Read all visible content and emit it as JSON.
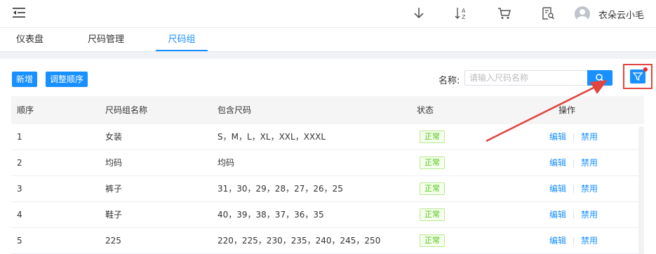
{
  "header": {
    "icons": [
      "menu-fold-icon",
      "download-icon",
      "sort-az-icon",
      "cart-icon",
      "document-search-icon"
    ],
    "username": "衣朵云小毛"
  },
  "tabs": [
    {
      "label": "仪表盘",
      "active": false
    },
    {
      "label": "尺码管理",
      "active": false
    },
    {
      "label": "尺码组",
      "active": true
    }
  ],
  "toolbar": {
    "add_label": "新增",
    "reorder_label": "调整顺序",
    "search_label": "名称:",
    "search_placeholder": "请输入尺码名称",
    "search_value": ""
  },
  "table": {
    "columns": [
      "顺序",
      "尺码组名称",
      "包含尺码",
      "状态",
      "操作"
    ],
    "rows": [
      {
        "order": "1",
        "name": "女装",
        "sizes": "S，M，L，XL，XXL，XXXL",
        "status": "正常"
      },
      {
        "order": "2",
        "name": "均码",
        "sizes": "均码",
        "status": "正常"
      },
      {
        "order": "3",
        "name": "裤子",
        "sizes": "31，30，29，28，27，26，25",
        "status": "正常"
      },
      {
        "order": "4",
        "name": "鞋子",
        "sizes": "40，39，38，37，36，35",
        "status": "正常"
      },
      {
        "order": "5",
        "name": "225",
        "sizes": "220，225，230，235，240，245，250",
        "status": "正常"
      }
    ],
    "actions": {
      "edit": "编辑",
      "disable": "禁用"
    }
  },
  "colors": {
    "primary": "#1890ff",
    "annotation": "#e0463f",
    "success": "#52c41a"
  }
}
